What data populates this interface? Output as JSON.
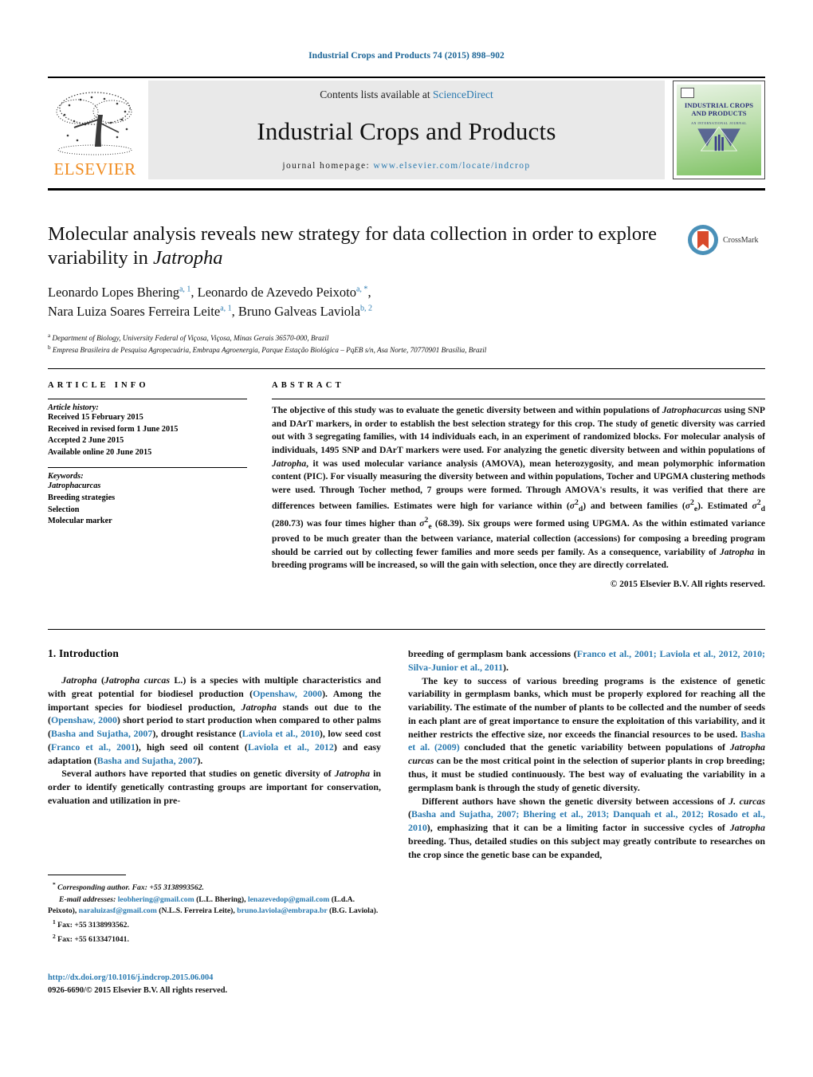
{
  "running_head": "Industrial Crops and Products 74 (2015) 898–902",
  "masthead": {
    "contents_prefix": "Contents lists available at ",
    "contents_link": "ScienceDirect",
    "journal_title": "Industrial Crops and Products",
    "homepage_label": "journal homepage:",
    "homepage_url": "www.elsevier.com/locate/indcrop",
    "publisher_wordmark": "ELSEVIER",
    "cover_title": "INDUSTRIAL CROPS AND PRODUCTS",
    "cover_subtitle": "AN INTERNATIONAL JOURNAL"
  },
  "article": {
    "title_part1": "Molecular analysis reveals new strategy for data collection in order to explore variability in ",
    "title_italic": "Jatropha",
    "crossmark_label": "CrossMark",
    "authors": [
      {
        "name": "Leonardo Lopes Bhering",
        "marks": "a, 1",
        "sep": ", "
      },
      {
        "name": "Leonardo de Azevedo Peixoto",
        "marks": "a, *",
        "sep": ","
      },
      {
        "name": "Nara Luiza Soares Ferreira Leite",
        "marks": "a, 1",
        "sep": ", "
      },
      {
        "name": "Bruno Galveas Laviola",
        "marks": "b, 2",
        "sep": ""
      }
    ],
    "affiliations": [
      {
        "mark": "a",
        "text": "Department of Biology, University Federal of Viçosa, Viçosa, Minas Gerais 36570-000, Brazil"
      },
      {
        "mark": "b",
        "text": "Empresa Brasileira de Pesquisa Agropecuária, Embrapa Agroenergia, Parque Estação Biológica – PqEB s/n, Asa Norte, 70770901 Brasília, Brazil"
      }
    ]
  },
  "article_info": {
    "heading": "ARTICLE INFO",
    "history_label": "Article history:",
    "history": [
      "Received 15 February 2015",
      "Received in revised form 1 June 2015",
      "Accepted 2 June 2015",
      "Available online 20 June 2015"
    ],
    "keywords_label": "Keywords:",
    "keywords": [
      "Jatrophacurcas",
      "Breeding strategies",
      "Selection",
      "Molecular marker"
    ]
  },
  "abstract": {
    "heading": "ABSTRACT",
    "p1_a": "The objective of this study was to evaluate the genetic diversity between and within populations of ",
    "p1_it1": "Jatrophacurcas",
    "p1_b": " using SNP and DArT markers, in order to establish the best selection strategy for this crop. The study of genetic diversity was carried out with 3 segregating families, with 14 individuals each, in an experiment of randomized blocks. For molecular analysis of individuals, 1495 SNP and DArT markers were used. For analyzing the genetic diversity between and within populations of ",
    "p1_it2": "Jatropha",
    "p1_c": ", it was used molecular variance analysis (AMOVA), mean heterozygosity, and mean polymorphic information content (PIC). For visually measuring the diversity between and within populations, Tocher and UPGMA clustering methods were used. Through Tocher method, 7 groups were formed. Through AMOVA's results, it was verified that there are differences between families. Estimates were high for variance within (",
    "sym_d": "σ",
    "sym_d_sub": "d",
    "sym_sup": "2",
    "p1_d": ") and between families (",
    "sym_e": "σ",
    "sym_e_sub": "e",
    "p1_e": "). Estimated ",
    "p1_f": " (280.73) was four times higher than ",
    "p1_g": " (68.39). Six groups were formed using UPGMA. As the within estimated variance proved to be much greater than the between variance, material collection (accessions) for composing a breeding program should be carried out by collecting fewer families and more seeds per family. As a consequence, variability of ",
    "p1_it3": "Jatropha",
    "p1_h": " in breeding programs will be increased, so will the gain with selection, once they are directly correlated.",
    "copyright": "© 2015 Elsevier B.V. All rights reserved."
  },
  "body": {
    "section_heading": "1.  Introduction",
    "left": {
      "p1": [
        {
          "t": "Jatropha",
          "s": "it"
        },
        {
          "t": " (",
          "s": ""
        },
        {
          "t": "Jatropha curcas",
          "s": "it"
        },
        {
          "t": " L.) is a species with multiple characteristics and with great potential for biodiesel production (",
          "s": ""
        },
        {
          "t": "Openshaw, 2000",
          "s": "lnk"
        },
        {
          "t": "). Among the important species for biodiesel production, ",
          "s": ""
        },
        {
          "t": "Jatropha",
          "s": "it"
        },
        {
          "t": " stands out due to the (",
          "s": ""
        },
        {
          "t": "Openshaw, 2000",
          "s": "lnk"
        },
        {
          "t": ") short period to start production when compared to other palms (",
          "s": ""
        },
        {
          "t": "Basha and Sujatha, 2007",
          "s": "lnk"
        },
        {
          "t": "), drought resistance (",
          "s": ""
        },
        {
          "t": "Laviola et al., 2010",
          "s": "lnk"
        },
        {
          "t": "), low seed cost (",
          "s": ""
        },
        {
          "t": "Franco et al., 2001",
          "s": "lnk"
        },
        {
          "t": "), high seed oil content (",
          "s": ""
        },
        {
          "t": "Laviola et al., 2012",
          "s": "lnk"
        },
        {
          "t": ") and easy adaptation (",
          "s": ""
        },
        {
          "t": "Basha and Sujatha, 2007",
          "s": "lnk"
        },
        {
          "t": ").",
          "s": ""
        }
      ],
      "p2": [
        {
          "t": "Several authors have reported that studies on genetic diversity of ",
          "s": ""
        },
        {
          "t": "Jatropha",
          "s": "it"
        },
        {
          "t": " in order to identify genetically contrasting groups are important for conservation, evaluation and utilization in pre-",
          "s": ""
        }
      ]
    },
    "right": {
      "p1": [
        {
          "t": "breeding of germplasm bank accessions (",
          "s": ""
        },
        {
          "t": "Franco et al., 2001; Laviola et al., 2012, 2010; Silva-Junior et al., 2011",
          "s": "lnk"
        },
        {
          "t": ").",
          "s": ""
        }
      ],
      "p2": [
        {
          "t": "The key to success of various breeding programs is the existence of genetic variability in germplasm banks, which must be properly explored for reaching all the variability. The estimate of the number of plants to be collected and the number of seeds in each plant are of great importance to ensure the exploitation of this variability, and it neither restricts the effective size, nor exceeds the financial resources to be used. ",
          "s": ""
        },
        {
          "t": "Basha et al. (2009)",
          "s": "lnk"
        },
        {
          "t": " concluded that the genetic variability between populations of ",
          "s": ""
        },
        {
          "t": "Jatropha curcas",
          "s": "it"
        },
        {
          "t": " can be the most critical point in the selection of superior plants in crop breeding; thus, it must be studied continuously. The best way of evaluating the variability in a germplasm bank is through the study of genetic diversity.",
          "s": ""
        }
      ],
      "p3": [
        {
          "t": "Different authors have shown the genetic diversity between accessions of ",
          "s": ""
        },
        {
          "t": "J. curcas",
          "s": "it"
        },
        {
          "t": " (",
          "s": ""
        },
        {
          "t": "Basha and Sujatha, 2007; Bhering et al., 2013; Danquah et al., 2012; Rosado et al., 2010",
          "s": "lnk"
        },
        {
          "t": "), emphasizing that it can be a limiting factor in successive cycles of ",
          "s": ""
        },
        {
          "t": "Jatropha",
          "s": "it"
        },
        {
          "t": " breeding. Thus, detailed studies on this subject may greatly contribute to researches on the crop since the genetic base can be expanded,",
          "s": ""
        }
      ]
    }
  },
  "footnotes": {
    "corresponding": "Corresponding author. Fax: +55 3138993562.",
    "corresponding_marker": "*",
    "email_label": "E-mail addresses:",
    "emails": [
      {
        "addr": "leobhering@gmail.com",
        "who": "(L.L. Bhering),"
      },
      {
        "addr": "lenazevedop@gmail.com",
        "who": "(L.d.A. Peixoto),"
      },
      {
        "addr": "naraluizasf@gmail.com",
        "who": "(N.L.S. Ferreira Leite),"
      },
      {
        "addr": "bruno.laviola@embrapa.br",
        "who": "(B.G. Laviola)."
      }
    ],
    "note1_marker": "1",
    "note1": "Fax: +55 3138993562.",
    "note2_marker": "2",
    "note2": "Fax: +55 6133471041."
  },
  "footer": {
    "doi": "http://dx.doi.org/10.1016/j.indcrop.2015.06.004",
    "issn_line": "0926-6690/© 2015 Elsevier B.V. All rights reserved."
  },
  "colors": {
    "link": "#2a7ab0",
    "running_head": "#1a6496",
    "elsevier_orange": "#f08c20",
    "masthead_bg": "#e9e9e9"
  }
}
